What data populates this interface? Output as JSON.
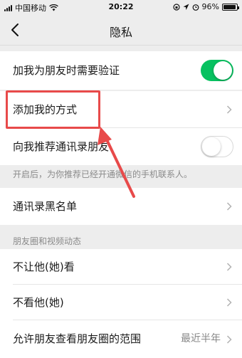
{
  "status_bar": {
    "carrier": "中国移动",
    "time": "20:22",
    "battery": "96%",
    "battery_level": 0.96
  },
  "nav": {
    "title": "隐私"
  },
  "items": {
    "verify_label": "加我为朋友时需要验证",
    "verify_on": true,
    "add_methods_label": "添加我的方式",
    "recommend_label": "向我推荐通讯录朋友",
    "recommend_on": false,
    "recommend_hint": "开启后，为你推荐已经开通微信的手机联系人。",
    "blacklist_label": "通讯录黑名单"
  },
  "moments_section": {
    "header": "朋友圈和视频动态",
    "hide_from_label": "不让他(她)看",
    "hide_label": "不看他(她)",
    "range_label": "允许朋友查看朋友圈的范围",
    "range_value": "最近半年"
  },
  "colors": {
    "toggle_on": "#07c160",
    "annotation_red": "#e84a4a"
  }
}
